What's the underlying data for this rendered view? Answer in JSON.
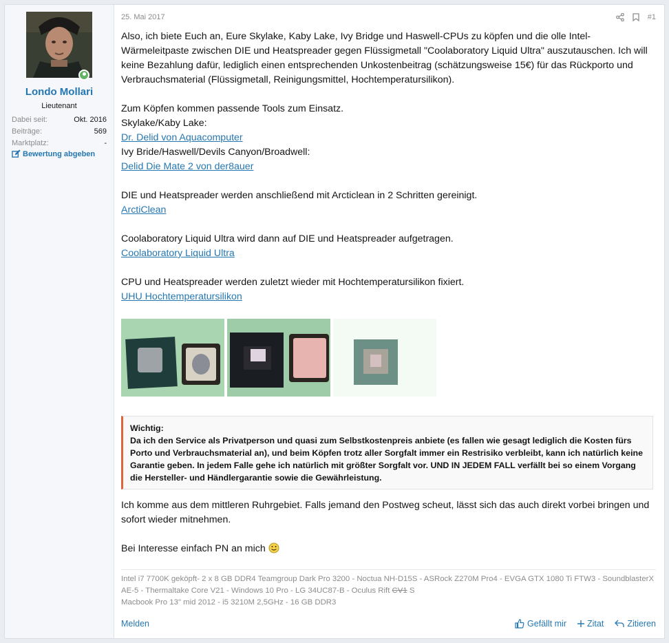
{
  "user": {
    "name": "Londo Mollari",
    "title": "Lieutenant",
    "stats": [
      {
        "key": "Dabei seit:",
        "value": "Okt. 2016"
      },
      {
        "key": "Beiträge:",
        "value": "569"
      },
      {
        "key": "Marktplatz:",
        "value": "-"
      }
    ],
    "rating_link": "Bewertung abgeben"
  },
  "post": {
    "date": "25. Mai 2017",
    "number": "#1",
    "intro": "Also, ich biete Euch an, Eure Skylake, Kaby Lake, Ivy Bridge und Haswell-CPUs zu köpfen und die olle Intel-Wärmeleitpaste zwischen DIE und Heatspreader gegen Flüssigmetall \"Coolaboratory Liquid Ultra\" auszutauschen. Ich will keine Bezahlung dafür, lediglich einen entsprechenden Unkostenbeitrag (schätzungsweise 15€) für das Rückporto und Verbrauchsmaterial (Flüssigmetall, Reinigungsmittel, Hochtemperatursilikon).",
    "tools_intro": "Zum Köpfen kommen passende Tools zum Einsatz.",
    "skylake_label": "Skylake/Kaby Lake:",
    "skylake_link": "Dr. Delid von Aquacomputer",
    "ivy_label": "Ivy Bride/Haswell/Devils Canyon/Broadwell:",
    "ivy_link": "Delid Die Mate 2 von der8auer",
    "clean_text": "DIE und Heatspreader werden anschließend mit Arcticlean in 2 Schritten gereinigt.",
    "clean_link": "ArctiClean",
    "liquid_text": "Coolaboratory Liquid Ultra wird dann auf DIE und Heatspreader aufgetragen.",
    "liquid_link": "Coolaboratory Liquid Ultra",
    "fix_text": "CPU und Heatspreader werden zuletzt wieder mit Hochtemperatursilikon fixiert.",
    "fix_link": "UHU Hochtemperatursilikon",
    "notice_title": "Wichtig:",
    "notice_text": "Da ich den Service als Privatperson und quasi zum Selbstkostenpreis anbiete (es fallen wie gesagt lediglich die Kosten fürs Porto und Verbrauchsmaterial an), und beim Köpfen trotz aller Sorgfalt immer ein Restrisiko verbleibt, kann ich natürlich keine Garantie geben. In jedem Falle gehe ich natürlich mit größter Sorgfalt vor. UND IN JEDEM FALL verfällt bei so einem Vorgang die Hersteller- und Händlergarantie sowie die Gewährleistung.",
    "location_text": "Ich komme aus dem mittleren Ruhrgebiet. Falls jemand den Postweg scheut, lässt sich das auch direkt vorbei bringen und sofort wieder mitnehmen.",
    "closing_text": "Bei Interesse einfach PN an mich"
  },
  "signature": {
    "line1": "Intel i7 7700K geköpft- 2 x 8 GB DDR4 Teamgroup Dark Pro 3200 - Noctua NH-D15S - ASRock Z270M Pro4 - EVGA GTX 1080 Ti FTW3 - SoundblasterX AE-5 - Thermaltake Core V21 - Windows 10 Pro - LG 34UC87-B - Oculus Rift",
    "struck": "CV1",
    "after_struck": "S",
    "line2": "Macbook Pro 13\" mid 2012 - i5 3210M 2,5GHz - 16 GB DDR3"
  },
  "footer": {
    "report": "Melden",
    "like": "Gefällt mir",
    "quote_plus": "Zitat",
    "quote": "Zitieren"
  },
  "colors": {
    "link": "#2577b1",
    "accent": "#e0633a",
    "online": "#63b265"
  }
}
